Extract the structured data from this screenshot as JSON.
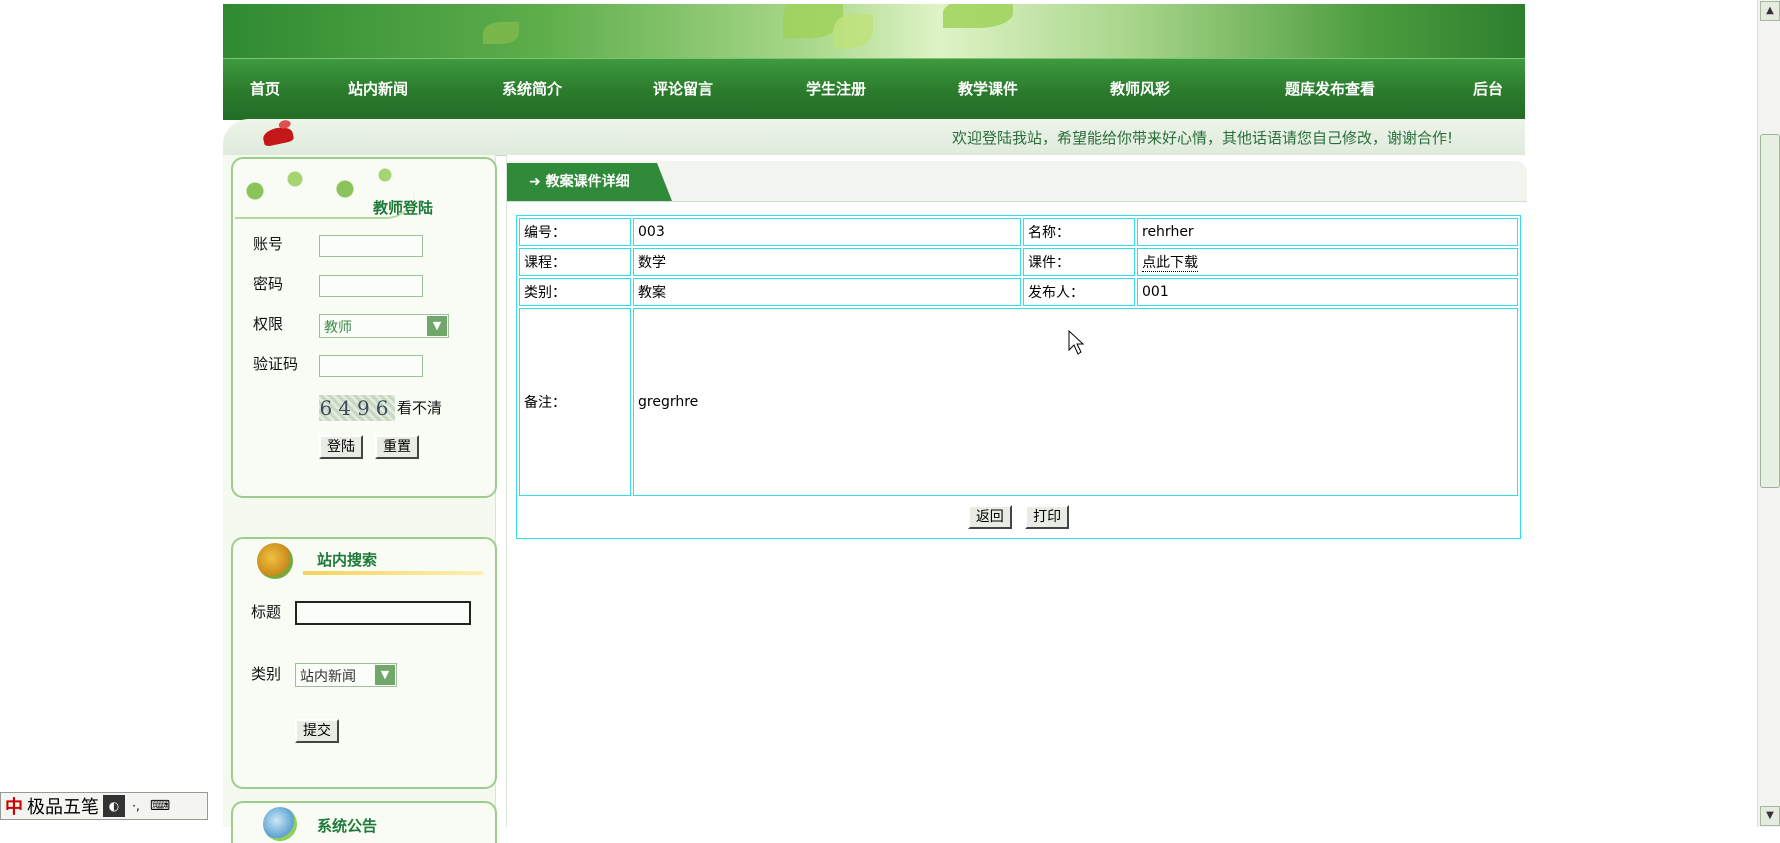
{
  "nav": {
    "items": [
      "首页",
      "站内新闻",
      "系统简介",
      "评论留言",
      "学生注册",
      "教学课件",
      "教师风彩",
      "题库发布查看",
      "后台"
    ]
  },
  "welcome": "欢迎登陆我站，希望能给你带来好心情，其他话语请您自己修改，谢谢合作!",
  "login": {
    "title": "教师登陆",
    "account_label": "账号",
    "password_label": "密码",
    "role_label": "权限",
    "role_value": "教师",
    "captcha_label": "验证码",
    "captcha_image_text": "6496",
    "captcha_refresh": "看不清",
    "login_button": "登陆",
    "reset_button": "重置"
  },
  "search": {
    "title": "站内搜索",
    "title_label": "标题",
    "category_label": "类别",
    "category_value": "站内新闻",
    "submit_button": "提交"
  },
  "announcement": {
    "title": "系统公告"
  },
  "detail": {
    "tab_title": "➜ 教案课件详细",
    "rows": {
      "id_label": "编号：",
      "id_value": "003",
      "name_label": "名称：",
      "name_value": "rehrher",
      "course_label": "课程：",
      "course_value": "数学",
      "file_label": "课件：",
      "file_value": "点此下载",
      "category_label": "类别：",
      "category_value": "教案",
      "publisher_label": "发布人：",
      "publisher_value": "001",
      "note_label": "备注：",
      "note_value": "gregrhre"
    },
    "back_button": "返回",
    "print_button": "打印"
  },
  "ime": {
    "mode": "中",
    "name": "极品五笔"
  },
  "colors": {
    "nav_green": "#2a7a2c",
    "title_green": "#1f7a3a",
    "table_border": "#30e0e8",
    "welcome_text": "#2a6e3a"
  }
}
